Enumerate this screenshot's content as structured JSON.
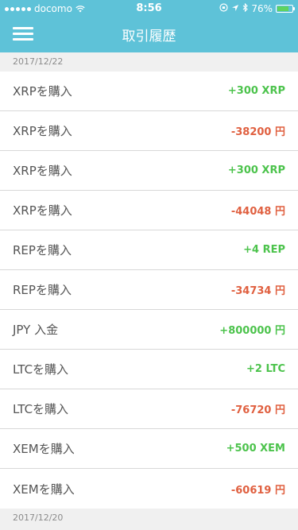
{
  "status_bar": {
    "carrier": "docomo",
    "time": "8:56",
    "battery_percent": "76%",
    "battery_level": 0.76
  },
  "header": {
    "title": "取引履歴"
  },
  "sections": [
    {
      "date": "2017/12/22",
      "items": [
        {
          "label": "XRPを購入",
          "amount": "+300 XRP",
          "positive": true
        },
        {
          "label": "XRPを購入",
          "amount": "-38200 円",
          "positive": false
        },
        {
          "label": "XRPを購入",
          "amount": "+300 XRP",
          "positive": true
        },
        {
          "label": "XRPを購入",
          "amount": "-44048 円",
          "positive": false
        },
        {
          "label": "REPを購入",
          "amount": "+4 REP",
          "positive": true
        },
        {
          "label": "REPを購入",
          "amount": "-34734 円",
          "positive": false
        },
        {
          "label": "JPY 入金",
          "amount": "+800000 円",
          "positive": true
        },
        {
          "label": "LTCを購入",
          "amount": "+2 LTC",
          "positive": true
        },
        {
          "label": "LTCを購入",
          "amount": "-76720 円",
          "positive": false
        },
        {
          "label": "XEMを購入",
          "amount": "+500 XEM",
          "positive": true
        },
        {
          "label": "XEMを購入",
          "amount": "-60619 円",
          "positive": false
        }
      ]
    },
    {
      "date": "2017/12/20",
      "items": []
    }
  ],
  "colors": {
    "header_bg": "#5ec2d8",
    "positive": "#4cc34c",
    "negative": "#e06040"
  }
}
